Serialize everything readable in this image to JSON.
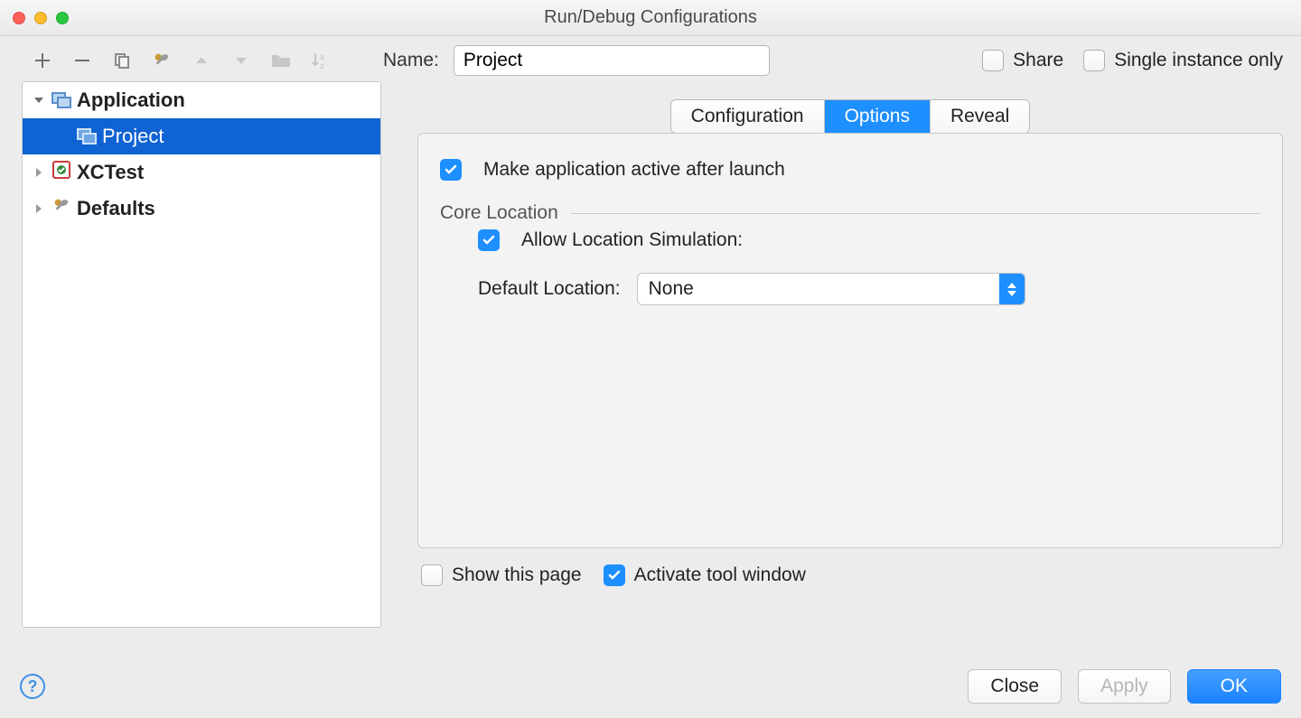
{
  "window_title": "Run/Debug Configurations",
  "toolbar": {},
  "name_field": {
    "label": "Name:",
    "value": "Project"
  },
  "share": {
    "label": "Share",
    "checked": false
  },
  "single_instance": {
    "label": "Single instance only",
    "checked": false
  },
  "tree": {
    "items": [
      {
        "label": "Application",
        "expanded": true,
        "children": [
          {
            "label": "Project",
            "selected": true
          }
        ]
      },
      {
        "label": "XCTest",
        "expanded": false
      },
      {
        "label": "Defaults",
        "expanded": false
      }
    ]
  },
  "tabs": {
    "items": [
      "Configuration",
      "Options",
      "Reveal"
    ],
    "active": 1
  },
  "options": {
    "make_active": {
      "label": "Make application active after launch",
      "checked": true
    },
    "core_location_section": "Core Location",
    "allow_sim": {
      "label": "Allow Location Simulation:",
      "checked": true
    },
    "default_location_label": "Default Location:",
    "default_location_value": "None"
  },
  "bottom": {
    "show_page": {
      "label": "Show this page",
      "checked": false
    },
    "activate_tool": {
      "label": "Activate tool window",
      "checked": true
    }
  },
  "footer": {
    "close": "Close",
    "apply": "Apply",
    "ok": "OK"
  }
}
